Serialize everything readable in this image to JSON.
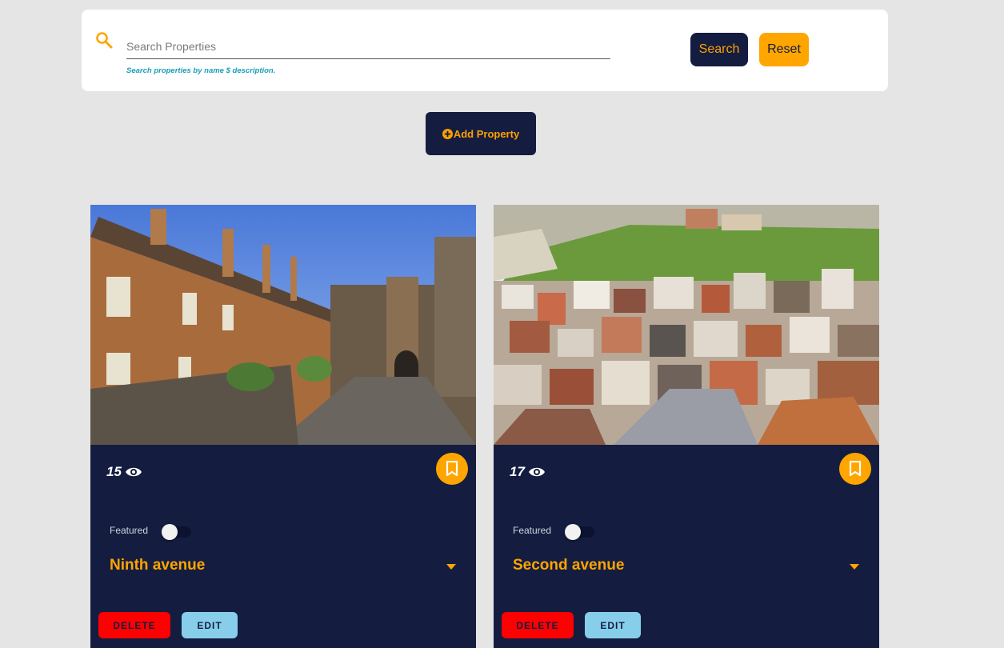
{
  "search": {
    "placeholder": "Search Properties",
    "value": "",
    "helper": "Search properties by name $ description.",
    "search_label": "Search",
    "reset_label": "Reset"
  },
  "actions": {
    "add_property_label": "Add Property"
  },
  "colors": {
    "navy": "#141d40",
    "accent": "#ffa500",
    "delete": "#ff0000",
    "edit": "#87ceeb",
    "background": "#e5e5e5"
  },
  "properties": [
    {
      "views": "15",
      "featured_label": "Featured",
      "featured": false,
      "title": "Ninth avenue",
      "delete_label": "DELETE",
      "edit_label": "EDIT",
      "image_icon": "stone-terrace-street-photo"
    },
    {
      "views": "17",
      "featured_label": "Featured",
      "featured": false,
      "title": "Second avenue",
      "delete_label": "DELETE",
      "edit_label": "EDIT",
      "image_icon": "hillside-town-rooftops-photo"
    }
  ]
}
